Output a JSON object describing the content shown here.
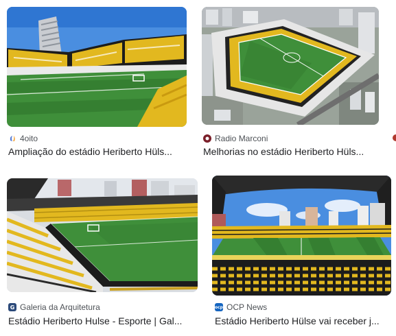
{
  "results": [
    {
      "source": "4oito",
      "source_icon": "4oito-logo-icon",
      "source_color": "#5b7fd6",
      "title": "Ampliação do estádio Heriberto Hüls..."
    },
    {
      "source": "Radio Marconi",
      "source_icon": "radio-marconi-logo-icon",
      "source_color": "#7b1f2a",
      "title": "Melhorias no estádio Heriberto Hüls..."
    },
    {
      "source": "Galeria da Arquitetura",
      "source_icon": "galeria-da-arquitetura-logo-icon",
      "source_color": "#2c4a7a",
      "source_glyph": "G",
      "title": "Estádio Heriberto Hulse - Esporte | Gal..."
    },
    {
      "source": "OCP News",
      "source_icon": "ocp-news-logo-icon",
      "source_color": "#1565c0",
      "source_glyph": "ocp",
      "title": "Estádio Heriberto Hülse vai receber j..."
    }
  ],
  "colors": {
    "pitch": "#3f8f3a",
    "pitch_dark": "#2f7a2e",
    "stand_yellow": "#e2b81f",
    "stand_black": "#1c1c1c",
    "sky": "#4a8ee0"
  }
}
